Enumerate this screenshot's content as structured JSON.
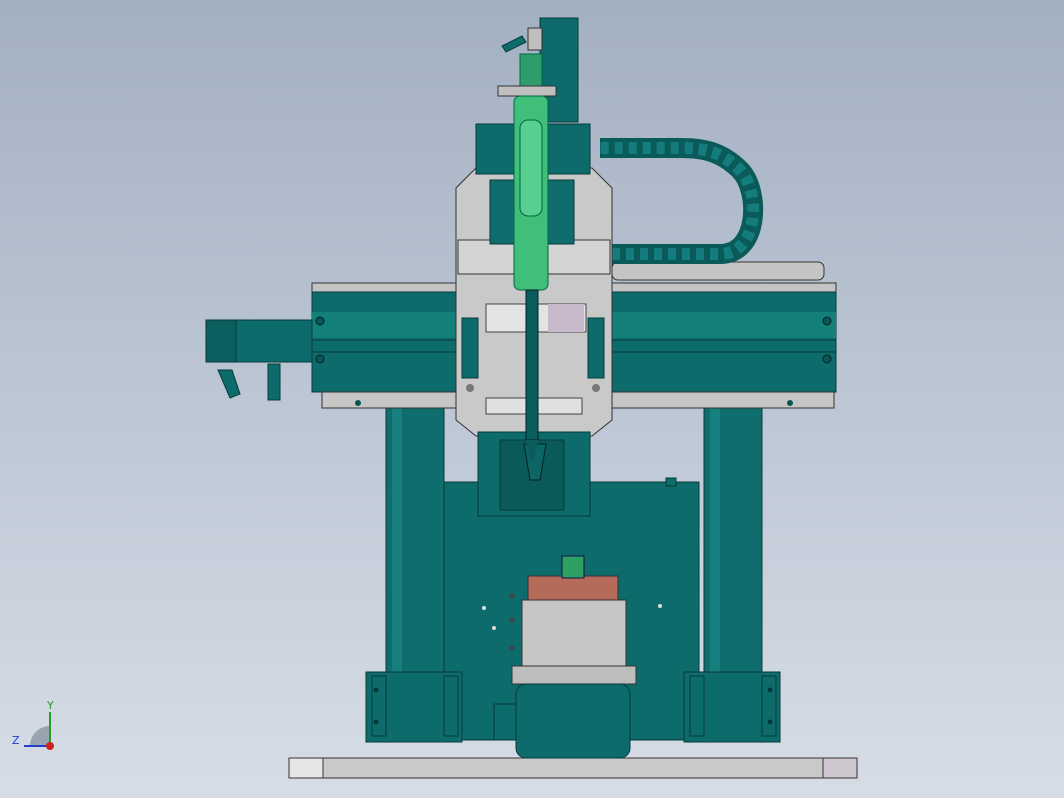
{
  "viewport": {
    "background_top": "#a3b0c2",
    "background_bottom": "#d6dde6"
  },
  "model": {
    "body_color": "#0e6b6b",
    "body_dark": "#074848",
    "body_light": "#16807f",
    "plate_color": "#c8c8c8",
    "syringe_color": "#3fbf7a",
    "heat_block_color": "#b56a5a"
  },
  "triad": {
    "y_label": "Y",
    "z_label": "Z",
    "x_color": "#d02020",
    "y_color": "#20a020",
    "z_color": "#2040d0"
  }
}
